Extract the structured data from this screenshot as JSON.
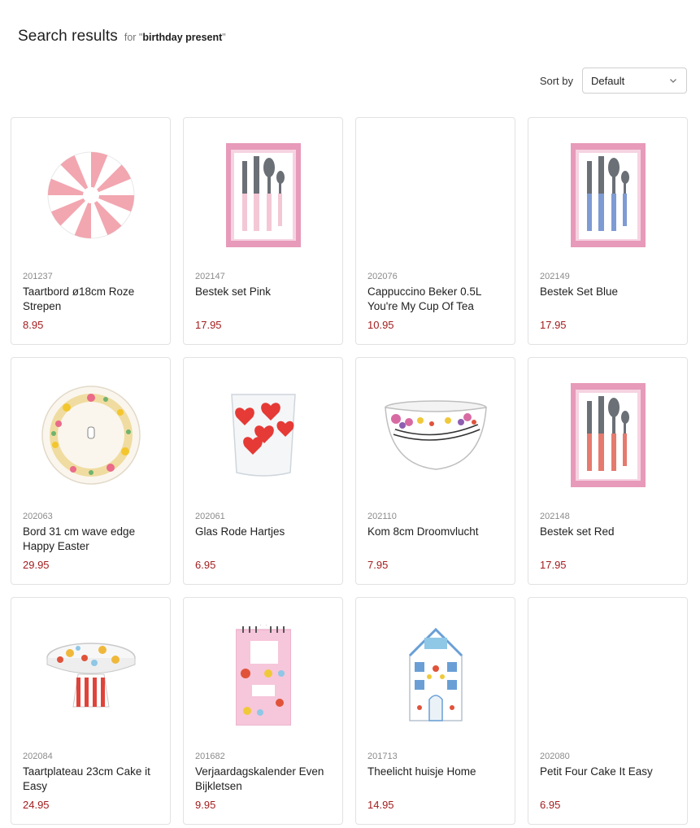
{
  "header": {
    "title": "Search results",
    "for_prefix": "for \"",
    "query": "birthday present",
    "for_suffix": "\""
  },
  "sort": {
    "label": "Sort by",
    "selected": "Default"
  },
  "products": [
    {
      "sku": "201237",
      "name": "Taartbord ø18cm Roze Strepen",
      "price": "8.95",
      "image": "pink-stripe-plate"
    },
    {
      "sku": "202147",
      "name": "Bestek set Pink",
      "price": "17.95",
      "image": "cutlery-set-pink"
    },
    {
      "sku": "202076",
      "name": "Cappuccino Beker 0.5L You're My Cup Of Tea",
      "price": "10.95",
      "image": "none"
    },
    {
      "sku": "202149",
      "name": "Bestek Set Blue",
      "price": "17.95",
      "image": "cutlery-set-blue"
    },
    {
      "sku": "202063",
      "name": "Bord 31 cm wave edge Happy Easter",
      "price": "29.95",
      "image": "easter-plate"
    },
    {
      "sku": "202061",
      "name": "Glas Rode Hartjes",
      "price": "6.95",
      "image": "heart-glass"
    },
    {
      "sku": "202110",
      "name": "Kom 8cm Droomvlucht",
      "price": "7.95",
      "image": "flower-bowl"
    },
    {
      "sku": "202148",
      "name": "Bestek set Red",
      "price": "17.95",
      "image": "cutlery-set-red"
    },
    {
      "sku": "202084",
      "name": "Taartplateau 23cm Cake it Easy",
      "price": "24.95",
      "image": "cake-stand"
    },
    {
      "sku": "201682",
      "name": "Verjaardagskalender Even Bijkletsen",
      "price": "9.95",
      "image": "birthday-calendar"
    },
    {
      "sku": "201713",
      "name": "Theelicht huisje Home",
      "price": "14.95",
      "image": "tealight-house"
    },
    {
      "sku": "202080",
      "name": "Petit Four Cake It Easy",
      "price": "6.95",
      "image": "none"
    }
  ],
  "colors": {
    "price": "#a31d1d",
    "border": "#e2e2e2"
  }
}
